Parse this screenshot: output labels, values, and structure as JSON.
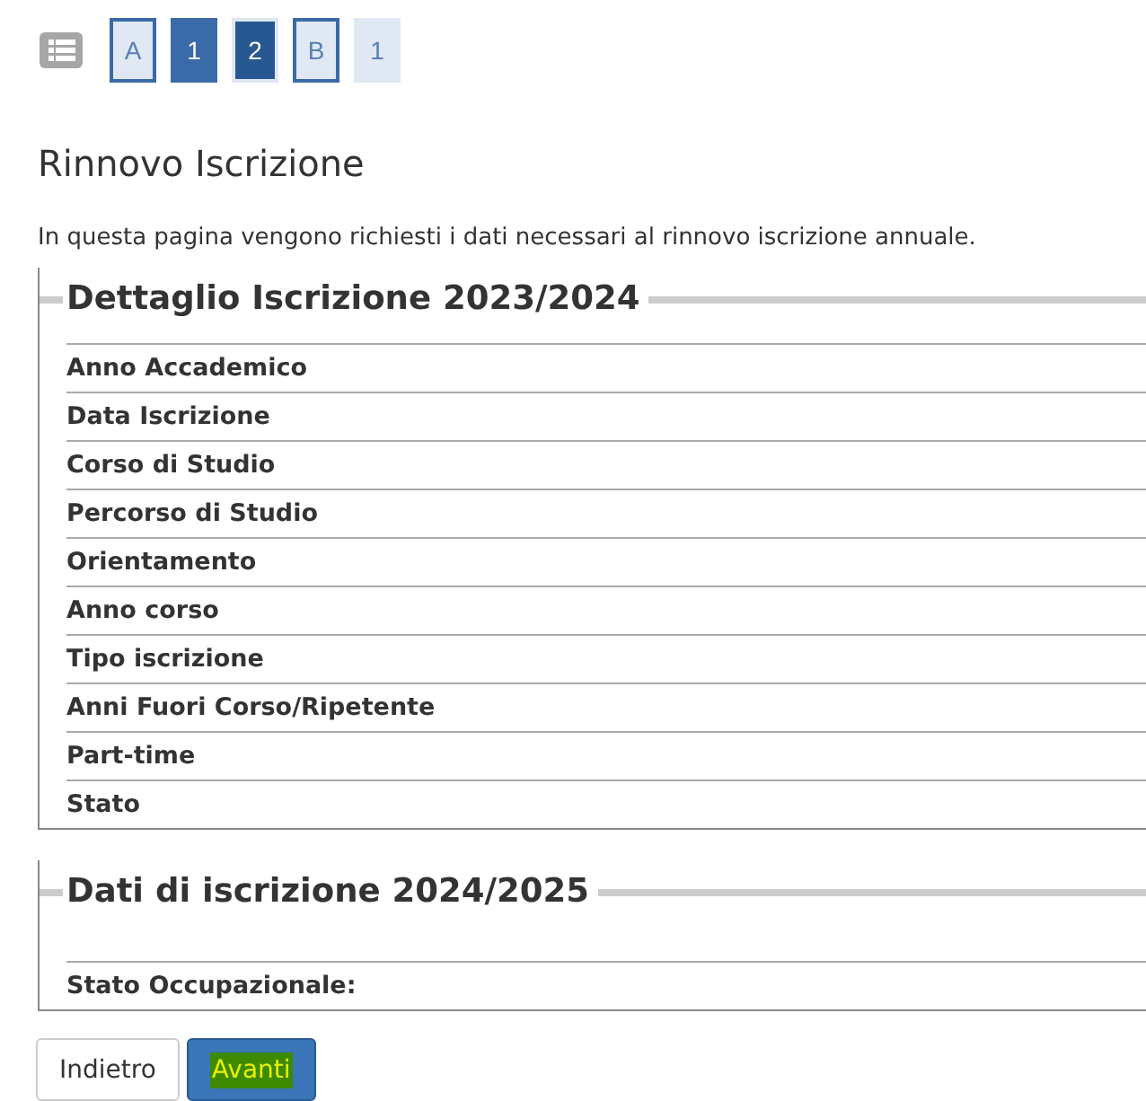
{
  "steps": [
    {
      "label": "A",
      "kind": "section"
    },
    {
      "label": "1",
      "kind": "done"
    },
    {
      "label": "2",
      "kind": "current"
    },
    {
      "label": "B",
      "kind": "section"
    },
    {
      "label": "1",
      "kind": "pending"
    }
  ],
  "title": "Rinnovo Iscrizione",
  "intro": "In questa pagina vengono richiesti i dati necessari al rinnovo iscrizione annuale.",
  "sections": [
    {
      "legend": "Dettaglio Iscrizione 2023/2024",
      "rows": [
        "Anno Accademico",
        "Data Iscrizione",
        "Corso di Studio",
        "Percorso di Studio",
        "Orientamento",
        "Anno corso",
        "Tipo iscrizione",
        "Anni Fuori Corso/Ripetente",
        "Part-time",
        "Stato"
      ]
    },
    {
      "legend": "Dati di iscrizione 2024/2025",
      "rows": [
        "Stato Occupazionale:"
      ]
    }
  ],
  "buttons": [
    {
      "label": "Indietro",
      "kind": "secondary"
    },
    {
      "label": "Avanti",
      "kind": "primary"
    }
  ]
}
